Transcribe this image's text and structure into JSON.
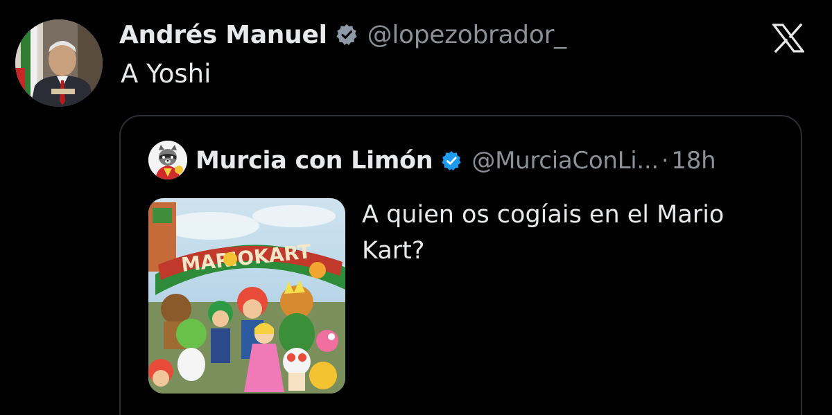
{
  "tweet": {
    "author_name": "Andrés Manuel",
    "handle": "@lopezobrador_",
    "text": "A Yoshi",
    "avatar_icon": "profile-photo",
    "verified_icon": "verified-badge-icon"
  },
  "platform": {
    "logo_icon": "x-logo-icon"
  },
  "quoted_tweet": {
    "author_name": "Murcia con Limón",
    "handle": "@MurciaConLi...",
    "separator": "·",
    "timestamp": "18h",
    "text": "A quien os cogíais en el Mario Kart?",
    "media": {
      "sign_text": "MARIOKART"
    },
    "avatar_icon": "raccoon-avatar",
    "verified_icon": "verified-badge-icon"
  },
  "colors": {
    "background": "#000000",
    "text_primary": "#e7e9ea",
    "text_secondary": "#8b9096",
    "verified_blue": "#1d9bf0",
    "card_border": "#2b2e32"
  }
}
